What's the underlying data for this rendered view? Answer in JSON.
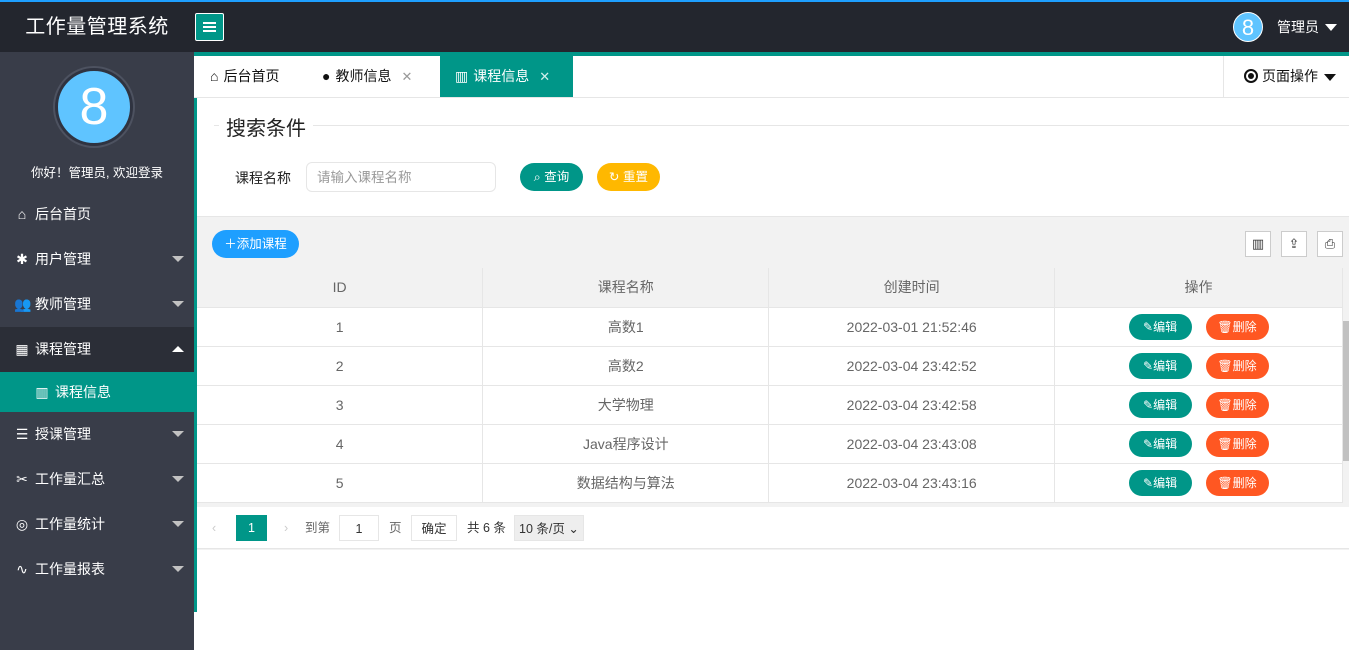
{
  "app": {
    "title": "工作量管理系统",
    "avatar_char": "8",
    "user_name": "管理员"
  },
  "sidebar": {
    "avatar_char": "8",
    "welcome": "你好！管理员, 欢迎登录",
    "items": [
      {
        "label": "后台首页",
        "icon": "home-icon",
        "glyph": "⌂"
      },
      {
        "label": "用户管理",
        "icon": "gear-icon",
        "glyph": "✱"
      },
      {
        "label": "教师管理",
        "icon": "users-icon",
        "glyph": "👥"
      },
      {
        "label": "课程管理",
        "icon": "apps-icon",
        "glyph": "▦"
      },
      {
        "label": "授课管理",
        "icon": "list-icon",
        "glyph": "☰"
      },
      {
        "label": "工作量汇总",
        "icon": "tools-icon",
        "glyph": "✂"
      },
      {
        "label": "工作量统计",
        "icon": "palette-icon",
        "glyph": "◎"
      },
      {
        "label": "工作量报表",
        "icon": "pulse-icon",
        "glyph": "∿"
      }
    ],
    "sub_item": {
      "label": "课程信息",
      "icon": "book-icon",
      "glyph": "▥"
    }
  },
  "tabs": [
    {
      "label": "后台首页",
      "icon": "home-icon",
      "glyph": "⌂"
    },
    {
      "label": "教师信息",
      "icon": "circle-icon",
      "glyph": "●",
      "close": "✕"
    },
    {
      "label": "课程信息",
      "icon": "book-icon",
      "glyph": "▥",
      "close": "✕"
    }
  ],
  "page_ops": "页面操作",
  "search": {
    "legend": "搜索条件",
    "label": "课程名称",
    "placeholder": "请输入课程名称",
    "query_label": "查询",
    "reset_label": "重置"
  },
  "toolbar": {
    "add_label": "添加课程"
  },
  "table": {
    "columns": [
      "ID",
      "课程名称",
      "创建时间",
      "操作"
    ],
    "edit_label": "编辑",
    "delete_label": "删除",
    "rows": [
      {
        "id": "1",
        "name": "高数1",
        "time": "2022-03-01 21:52:46"
      },
      {
        "id": "2",
        "name": "高数2",
        "time": "2022-03-04 23:42:52"
      },
      {
        "id": "3",
        "name": "大学物理",
        "time": "2022-03-04 23:42:58"
      },
      {
        "id": "4",
        "name": "Java程序设计",
        "time": "2022-03-04 23:43:08"
      },
      {
        "id": "5",
        "name": "数据结构与算法",
        "time": "2022-03-04 23:43:16"
      }
    ]
  },
  "pager": {
    "current": "1",
    "goto": "到第",
    "input_value": "1",
    "page": "页",
    "confirm": "确定",
    "total": "共 6 条",
    "page_size": "10 条/页"
  },
  "colors": {
    "primary": "#009688",
    "warn": "#ffb800",
    "danger": "#ff5722",
    "blue": "#1e9fff",
    "header": "#23262e",
    "sidebar": "#393d49"
  }
}
